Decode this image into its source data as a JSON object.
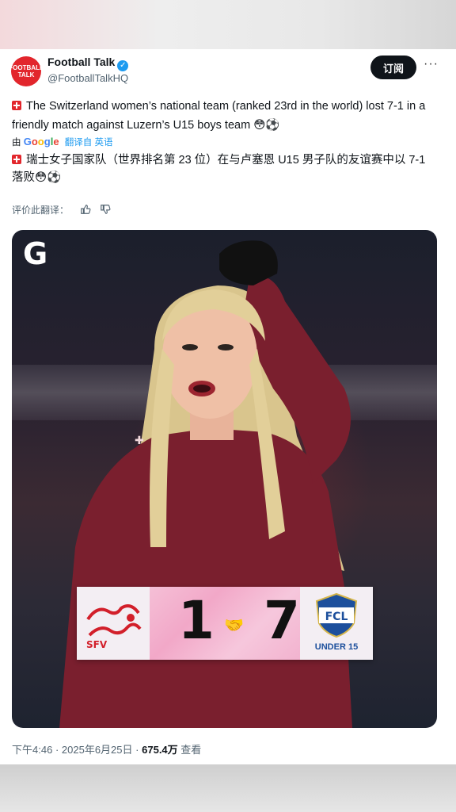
{
  "author": {
    "name": "Football Talk",
    "handle": "@FootballTalkHQ",
    "avatar_text": "FOOTBALL TALK"
  },
  "actions": {
    "subscribe_label": "订阅",
    "more_label": "···"
  },
  "tweet": {
    "text_en": "The Switzerland women’s national team (ranked 23rd in the world) lost 7-1 in a friendly match against Luzern’s U15 boys team 😳⚽",
    "translation_prefix": "由",
    "translation_suffix": "翻译自 英语",
    "text_zh": "瑞士女子国家队（世界排名第 23 位）在与卢塞恩 U15 男子队的友谊赛中以 7-1 落败😳⚽",
    "rate_label": "评价此翻译："
  },
  "media": {
    "logo_letter": "G",
    "scoreboard": {
      "home_score": "1",
      "away_score": "7",
      "away_crest_text": "FCL",
      "away_label": "UNDER 15",
      "home_crest_text": "SFV"
    }
  },
  "meta": {
    "time": "下午4:46",
    "separator": "·",
    "date": "2025年6月25日",
    "views": "675.4万",
    "views_label": "查看"
  },
  "colors": {
    "accent": "#1d9bf0",
    "brand_red": "#e2262c",
    "jersey": "#7a1f2e"
  }
}
